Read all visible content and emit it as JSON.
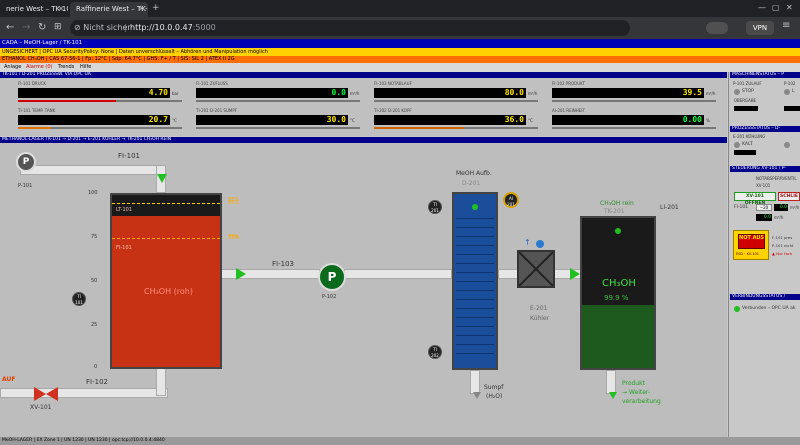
{
  "browser": {
    "tabs": [
      {
        "label": "nerie West – TK-101 M..."
      },
      {
        "label": "Raffinerie West – TK-101 M..."
      }
    ],
    "security_label": "Nicht sicher",
    "url_host": "http://10.0.0.47",
    "url_port": ":5000",
    "vpn_label": "VPN"
  },
  "scada": {
    "header1": "CADA – MeOH-Lager / TK-101",
    "header2": "UNGESICHERT  |  OPC UA SecurityPolicy: None  |  Daten unverschlüsselt – Abhören und Manipulation möglich",
    "header3": "ETHANOL CH₃OH  |  CAS 67-56-1  |  Fp: 12°C  |  Sdp: 64.7°C  |  GHS: F+ / T  |  SIS: SIL 2  |  ATEX II 2G",
    "menu": [
      "Anlage",
      "Alarme (0)",
      "Trends",
      "Hilfe"
    ]
  },
  "measure_section": {
    "title": "TK-101 / D-201 PROZESSW. VIA OPC UA",
    "items": [
      {
        "label": "FI-101 DRUCK",
        "value": "4.70",
        "unit": "bar",
        "bar_fraction": 0.6,
        "bar_color": "#d00000",
        "color": "yellow"
      },
      {
        "label": "FI-101 ZUFLUSS",
        "value": "0.0",
        "unit": "m³/h",
        "bar_fraction": 0.0,
        "bar_color": "#d00000",
        "color": "green"
      },
      {
        "label": "FI-103 NOTABLAUF",
        "value": "80.0",
        "unit": "m³/h",
        "bar_fraction": 0.0,
        "bar_color": "#d00000",
        "color": "yellow"
      },
      {
        "label": "FI-102 PRODUKT",
        "value": "39.5",
        "unit": "m³/h",
        "bar_fraction": 0.0,
        "bar_color": "#d00000",
        "color": "yellow"
      },
      {
        "label": "TI-101 TEMP. TANK",
        "value": "20.7",
        "unit": "°C",
        "bar_fraction": 0.2,
        "bar_color": "#e07000",
        "color": "yellow"
      },
      {
        "label": "TI-201 D-201 SUMPF",
        "value": "30.0",
        "unit": "°C",
        "bar_fraction": 0.0,
        "bar_color": "#d00000",
        "color": "yellow"
      },
      {
        "label": "TI-202 D-201 KOPF",
        "value": "36.0",
        "unit": "°C",
        "bar_fraction": 0.55,
        "bar_color": "#d06000",
        "color": "yellow"
      },
      {
        "label": "AI-201 REINHEIT",
        "value": "0.00",
        "unit": "%",
        "bar_fraction": 0.0,
        "bar_color": "#d00000",
        "color": "green"
      }
    ]
  },
  "process": {
    "title": "METHANOL-LAGER TK-101 → D-201 → E-201 KÜHLER → TK-201 CH₃OH REIN",
    "fi101": "FI-101",
    "p101": "P-101",
    "scale": [
      "100",
      "75",
      "50",
      "25",
      "0"
    ],
    "tk101_hh": "95%",
    "tk101_h": "75%",
    "tk101_li": "LT-101",
    "tk101_fi": "FI-101",
    "tk101_name": "CH₃OH (roh)",
    "ti101": "TI 101",
    "fi103": "FI-103",
    "p102": "P-102",
    "auf": "AUF",
    "xv101": "XV-101",
    "fi102": "FI-102",
    "d201_name": "MeOH Aufb.",
    "d201_tag": "D-201",
    "ti201": "TI 201",
    "ti202": "TI 202",
    "ai201": "AI 201",
    "sumpf": "Sumpf",
    "sumpf2": "(H₂O)",
    "e201": "E-201",
    "kuehler": "Kühler",
    "tk201_name": "CH₃OH rein",
    "tk201_tag": "TK-201",
    "li201": "LI-201",
    "tk201_product": "CH₃OH",
    "tk201_purity": "99.9 %",
    "produkt1": "Produkt",
    "produkt2": "→ Weiter-",
    "produkt3": "verarbeitung",
    "tk101_level": 0.88,
    "tk201_level": 0.42
  },
  "right_panel": {
    "maschinen_title": "MASCHINENSTATUS – P",
    "p101_label": "P-101 ZULAUF",
    "p101_state": "STOP",
    "p101_mode": "ÜBERGABE",
    "p102_label": "P-102",
    "p102_state": "L",
    "prozess_title": "PROZESSSTATUS – D-",
    "e201_label": "E-201 KÜHLUNG",
    "e201_state": "KALT",
    "steuerung_title": "STEUERUNG XV-101 / P-",
    "notabsperr": "NOTABSPERRVENTIL",
    "xv101": "XV-101",
    "btn_open": "XV-101 ÖFFNEN",
    "btn_close": "SCHLIE",
    "fi101_label": "FI-101",
    "fi101_minus": "−20",
    "fi101_unit": "m³/h",
    "fi101_val1": "0.0",
    "fi101_val2": "0.0",
    "not_aus": "NOT AUS",
    "esd": "ESD · XV-101",
    "not_note1": "F-101 pres",
    "not_note2": "P-101 nicht",
    "not_note3": "▲ Nur fach",
    "verbindung_title": "VERBINDUNGSSTATUS /",
    "verbindung_text": "Verbunden – OPC UA ak"
  },
  "statusbar": "MeOH-LAGER  |  EX Zone 1  |  UN 1230  |  UN 1230  |  opc.tcp://10.0.0.4:4840",
  "colors": {
    "tk101_fill": "#c83214",
    "tk201_fill": "#1e5a1e",
    "d201_fill": "#1a4e9a",
    "header_blue": "#0000b4",
    "warning_yellow": "#ffd200",
    "warning_orange": "#ff6f00"
  }
}
